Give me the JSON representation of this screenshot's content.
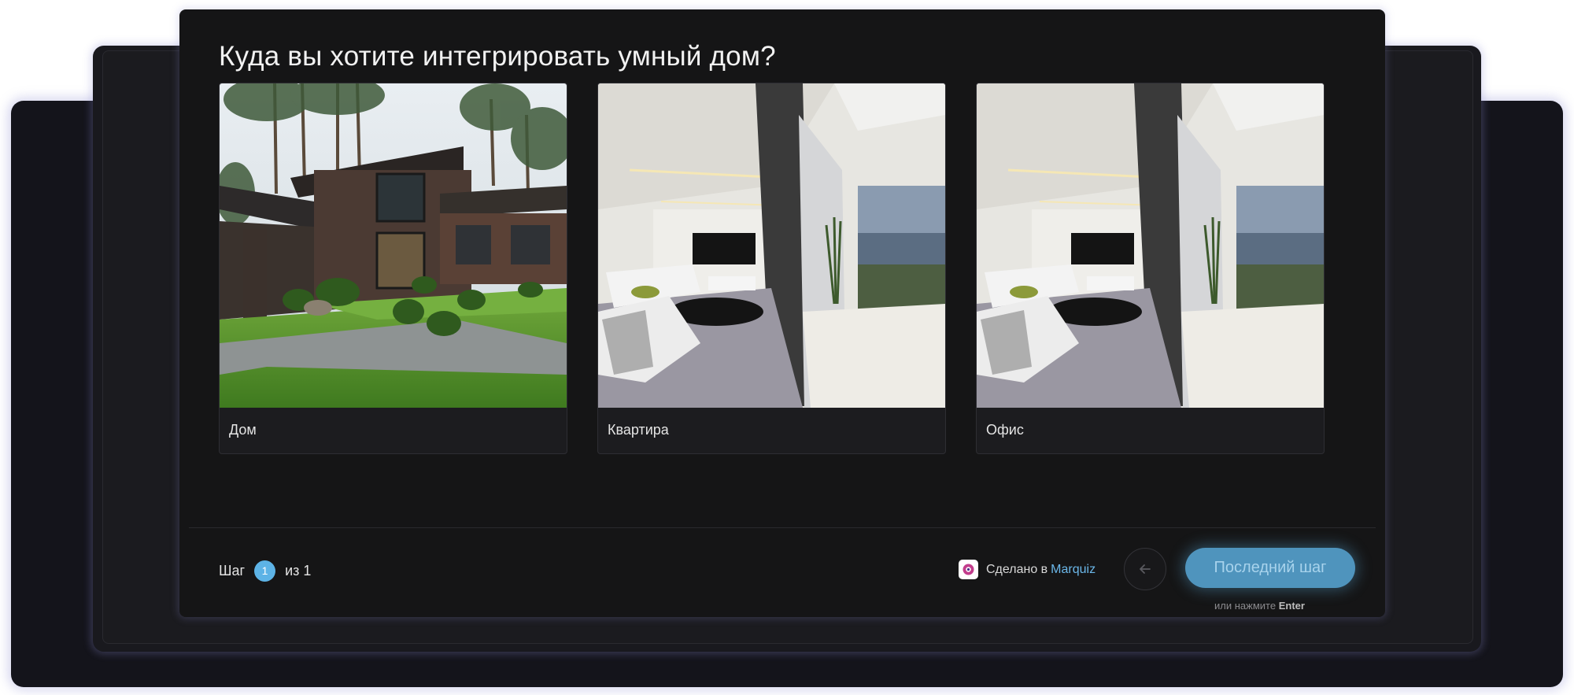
{
  "quiz": {
    "question": "Куда вы хотите интегрировать умный дом?",
    "options": [
      {
        "label": "Дом",
        "image": "house-exterior-garden"
      },
      {
        "label": "Квартира",
        "image": "apartment-living-room"
      },
      {
        "label": "Офис",
        "image": "office-living-room"
      }
    ]
  },
  "footer": {
    "step_word": "Шаг",
    "step_current": "1",
    "step_of": "из 1",
    "made_in": "Сделано в",
    "brand": "Marquiz",
    "next_label": "Последний шаг",
    "hint_prefix": "или нажмите",
    "hint_key": "Enter"
  },
  "colors": {
    "accent": "#5db3e6",
    "button": "#4f94bd",
    "window_bg": "#151516",
    "backdrop": "#14141b"
  },
  "icons": [
    "marquiz-logo-icon",
    "arrow-left-icon"
  ]
}
